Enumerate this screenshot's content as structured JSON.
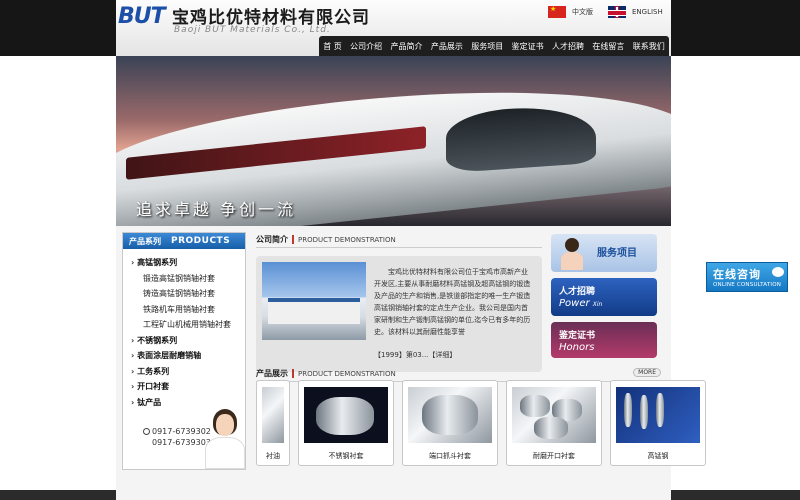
{
  "header": {
    "logo_mark": "BUT",
    "company_name": "宝鸡比优特材料有限公司",
    "company_name_en": "Baoji BUT Materials Co., Ltd.",
    "lang_cn": "中文版",
    "lang_en": "ENGLISH"
  },
  "nav": [
    "首 页",
    "公司介绍",
    "产品简介",
    "产品展示",
    "服务项目",
    "鉴定证书",
    "人才招聘",
    "在线留言",
    "联系我们"
  ],
  "banner": {
    "slogan": "追求卓越  争创一流"
  },
  "sidebar": {
    "title_cn": "产品系列",
    "title_en": "PRODUCTS",
    "items": [
      {
        "label": "高锰钢系列",
        "level": "main"
      },
      {
        "label": "锻造高锰钢销轴衬套",
        "level": "sub"
      },
      {
        "label": "铸造高锰钢销轴衬套",
        "level": "sub"
      },
      {
        "label": "铁路机车用销轴衬套",
        "level": "sub"
      },
      {
        "label": "工程矿山机械用销轴衬套",
        "level": "sub"
      },
      {
        "label": "不锈钢系列",
        "level": "main"
      },
      {
        "label": "表面涂层耐磨销轴",
        "level": "main"
      },
      {
        "label": "工务系列",
        "level": "main"
      },
      {
        "label": "开口衬套",
        "level": "main"
      },
      {
        "label": "钛产品",
        "level": "main"
      }
    ],
    "phones": [
      "0917-6739302",
      "0917-6739303"
    ]
  },
  "intro": {
    "title_cn": "公司简介",
    "title_en": "PRODUCT DEMONSTRATION",
    "text": "宝鸡比优特材料有限公司位于宝鸡市高新产业开发区,主要从事耐磨材料高锰钢及超高锰钢的锻造及产品的生产和销售,是铁道部指定的唯一生产锻造高锰钢销轴衬套的定点生产企业。我公司是国内首家研制和生产锻制高锰钢的单位,迄今已有多年的历史。该材料以其耐磨性能享誉",
    "more": "【1999】第03...【详细】"
  },
  "products": {
    "title_cn": "产品展示",
    "title_en": "PRODUCT DEMONSTRATION",
    "more": "MORE",
    "items": [
      "衬油",
      "不锈钢衬套",
      "端口抓斗衬套",
      "耐磨开口衬套",
      "高锰钢"
    ]
  },
  "right": {
    "service": "服务项目",
    "talent_cn": "人才招聘",
    "talent_en_main": "Power",
    "talent_en_small": "Xin",
    "honor_cn": "鉴定证书",
    "honor_en": "Honors"
  },
  "float_consult": {
    "cn": "在线咨询",
    "en": "ONLINE CONSULTATION"
  }
}
